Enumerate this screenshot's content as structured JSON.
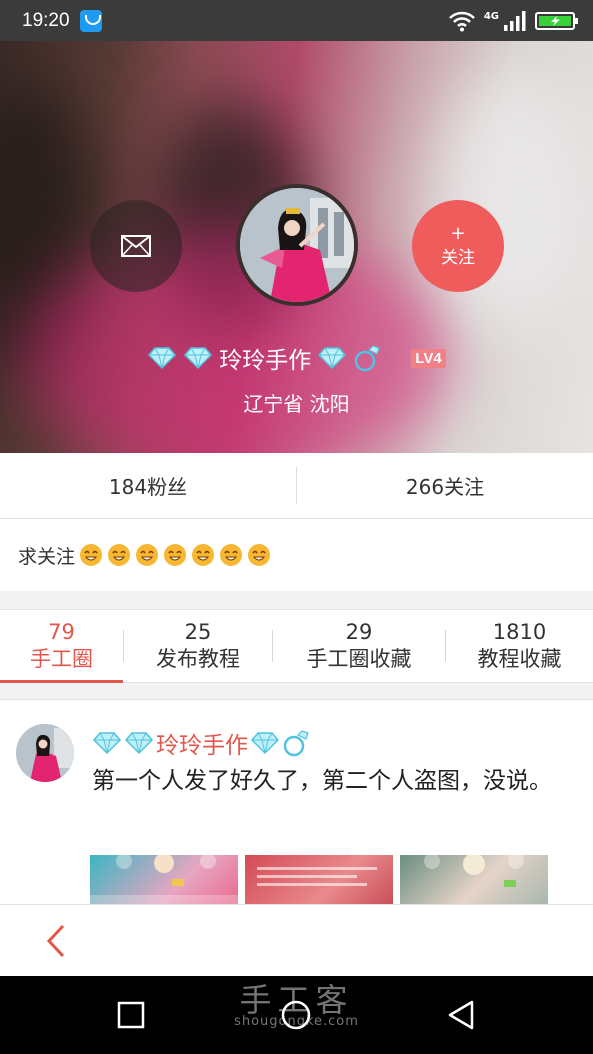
{
  "status_bar": {
    "time": "19:20",
    "network": "4G"
  },
  "profile": {
    "name": "玲玲手作",
    "level": "LV4",
    "location": "辽宁省 沈阳",
    "follow_label": "关注",
    "follow_plus": "+"
  },
  "stats": {
    "fans": "184粉丝",
    "following": "266关注"
  },
  "bio": {
    "text": "求关注"
  },
  "tabs": [
    {
      "count": "79",
      "label": "手工圈"
    },
    {
      "count": "25",
      "label": "发布教程"
    },
    {
      "count": "29",
      "label": "手工圈收藏"
    },
    {
      "count": "1810",
      "label": "教程收藏"
    }
  ],
  "post": {
    "author": "玲玲手作",
    "text": "第一个人发了好久了，第二个人盗图，没说。"
  },
  "watermark": {
    "main": "手工客",
    "url": "shougongke.com"
  },
  "colors": {
    "accent": "#e2574c",
    "follow": "#ef5c5b",
    "level_badge": "#f07f86"
  }
}
